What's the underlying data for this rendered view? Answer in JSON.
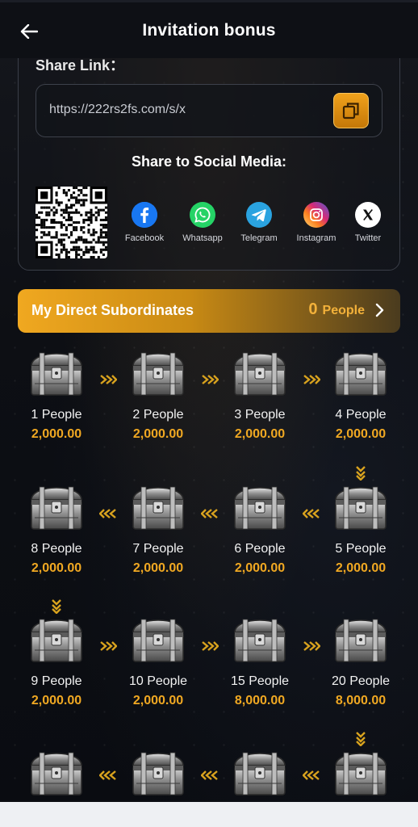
{
  "header": {
    "title": "Invitation bonus"
  },
  "share": {
    "label": "Share Link：",
    "link": "https://222rs2fs.com/s/x",
    "social_title": "Share to Social Media:",
    "socials": [
      {
        "name": "Facebook",
        "icon": "facebook-icon",
        "color": "#1877f2"
      },
      {
        "name": "Whatsapp",
        "icon": "whatsapp-icon",
        "color": "#25d366"
      },
      {
        "name": "Telegram",
        "icon": "telegram-icon",
        "color": "#2aa3e0"
      },
      {
        "name": "Instagram",
        "icon": "instagram-icon",
        "color": "#d62976"
      },
      {
        "name": "Twitter",
        "icon": "x-icon",
        "color": "#ffffff"
      }
    ]
  },
  "subordinates": {
    "label": "My Direct Subordinates",
    "count": "0",
    "unit": "People"
  },
  "rewards": [
    {
      "people": "1 People",
      "amount": "2,000.00"
    },
    {
      "people": "2 People",
      "amount": "2,000.00"
    },
    {
      "people": "3 People",
      "amount": "2,000.00"
    },
    {
      "people": "4 People",
      "amount": "2,000.00"
    },
    {
      "people": "8 People",
      "amount": "2,000.00"
    },
    {
      "people": "7 People",
      "amount": "2,000.00"
    },
    {
      "people": "6 People",
      "amount": "2,000.00"
    },
    {
      "people": "5 People",
      "amount": "2,000.00"
    },
    {
      "people": "9 People",
      "amount": "2,000.00"
    },
    {
      "people": "10 People",
      "amount": "2,000.00"
    },
    {
      "people": "15 People",
      "amount": "8,000.00"
    },
    {
      "people": "20 People",
      "amount": "8,000.00"
    }
  ],
  "colors": {
    "accent": "#f0a822",
    "background": "#0b0d12"
  }
}
